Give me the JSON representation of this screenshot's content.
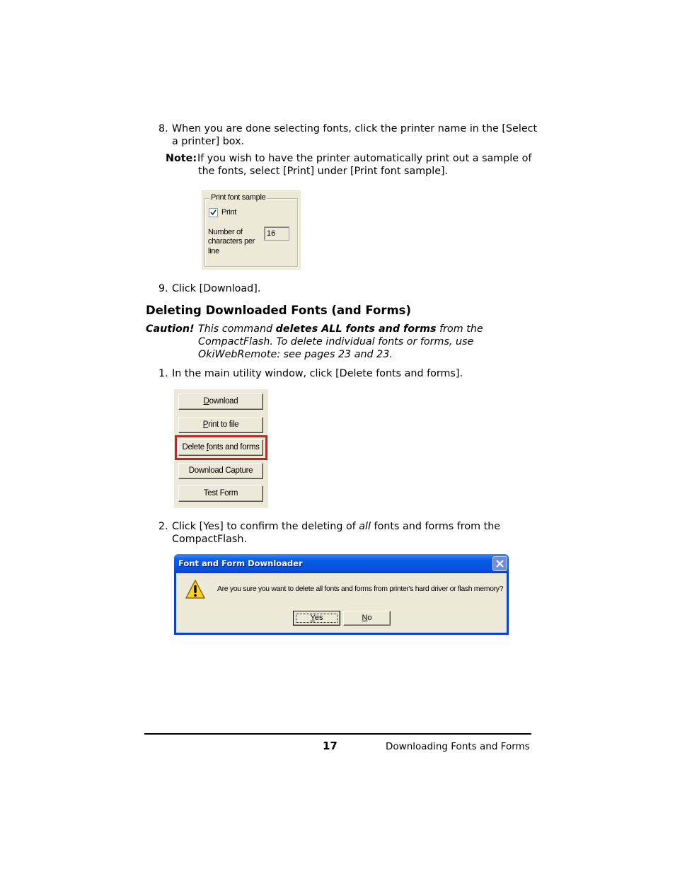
{
  "step8": {
    "number": "8.",
    "line1": "When you are done selecting fonts, click the printer name in the [Select",
    "line2": "a printer] box."
  },
  "note": {
    "label": "Note:",
    "line1": "If you wish to have the printer automatically print out a sample of",
    "line2": "the fonts, select [Print] under [Print font sample]."
  },
  "print_font_sample": {
    "legend": "Print font sample",
    "print_checkbox_label": "Print",
    "print_checked": true,
    "chars_label_line1": "Number of",
    "chars_label_line2": "characters per",
    "chars_label_line3": "line",
    "chars_value": "16"
  },
  "step9": {
    "number": "9.",
    "text": "Click [Download]."
  },
  "section_heading": "Deleting Downloaded Fonts (and Forms)",
  "caution": {
    "label": "Caution!",
    "line1_pre": "This command ",
    "line1_bold": "deletes ALL fonts and forms",
    "line1_post": " from the",
    "line2": "CompactFlash. To delete individual fonts or forms, use",
    "line3": "OkiWebRemote: see pages 23 and 23."
  },
  "step1": {
    "number": "1.",
    "text": "In the main utility window, click [Delete fonts and forms]."
  },
  "utility_buttons": [
    {
      "label": "Download",
      "accel": "D"
    },
    {
      "label": "Print to file",
      "accel": "P"
    },
    {
      "label": "Delete fonts and forms",
      "accel": "f",
      "highlighted": true
    },
    {
      "label": "Download Capture"
    },
    {
      "label": "Test Form"
    }
  ],
  "step2": {
    "number": "2.",
    "line1_pre": "Click [Yes] to confirm the deleting of ",
    "line1_italic": "all",
    "line1_post": " fonts and forms from the",
    "line2": "CompactFlash."
  },
  "dialog": {
    "title": "Font and Form Downloader",
    "icon": "warning-icon",
    "message": "Are you sure you want to delete all fonts and forms from printer's hard driver or flash memory?",
    "yes_label": "Yes",
    "no_label": "No",
    "close_icon": "close-icon"
  },
  "footer": {
    "page_number": "17",
    "section_title": "Downloading Fonts and Forms"
  },
  "colors": {
    "highlight_border": "#e8141c",
    "dialog_title_blue": "#0a5ce8",
    "window_face": "#ece9d8"
  }
}
